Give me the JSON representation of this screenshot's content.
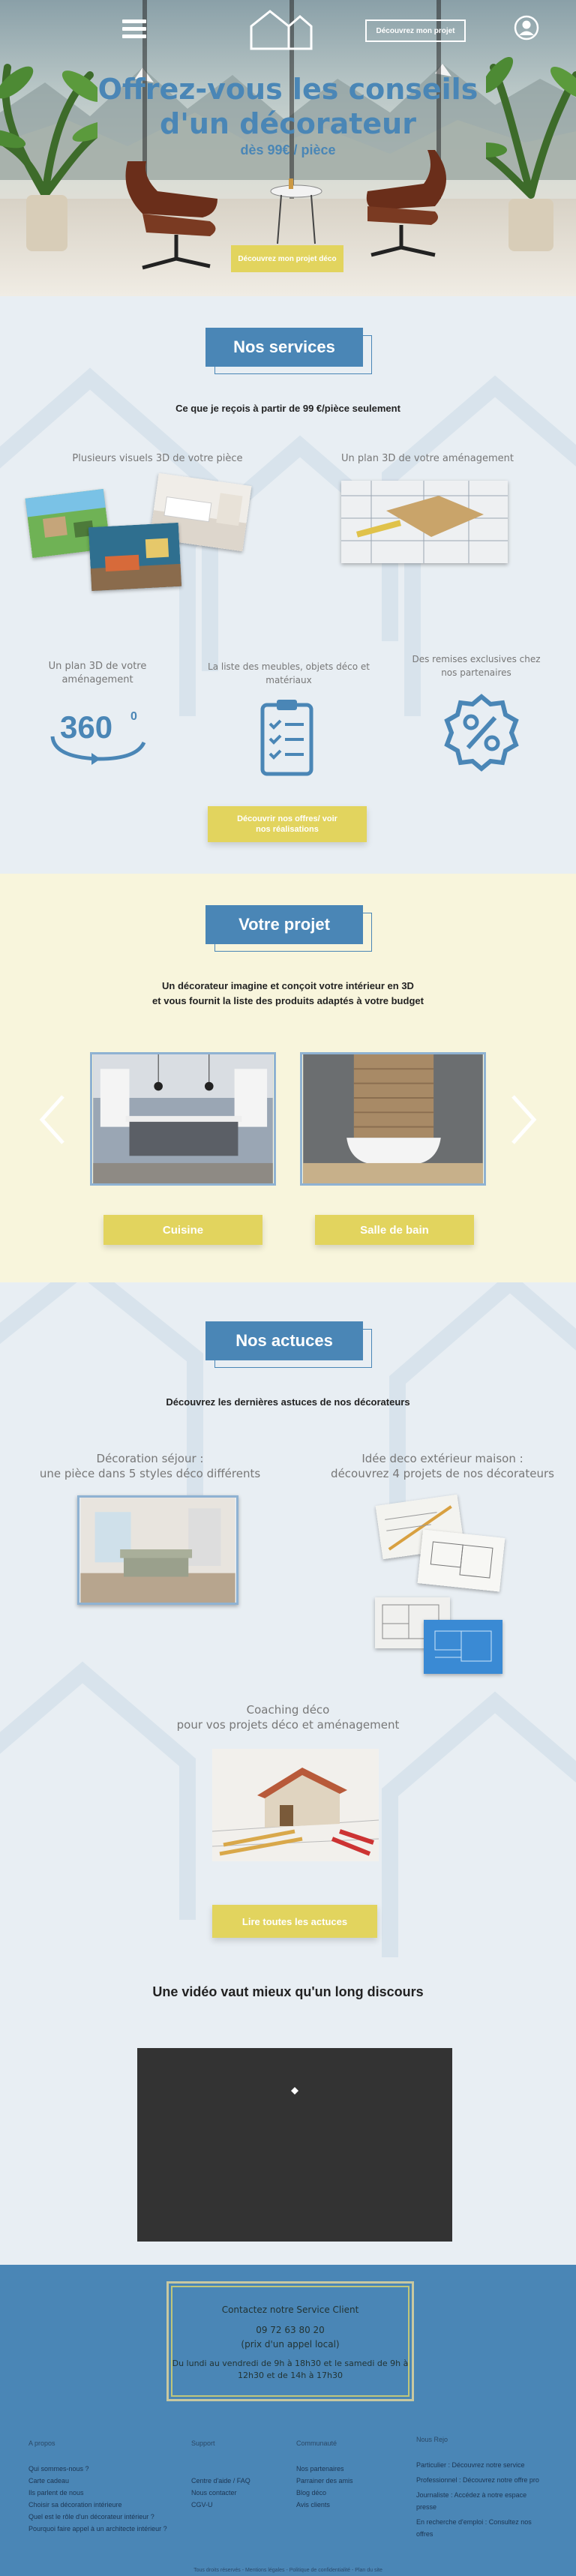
{
  "header": {
    "cta_label": "Découvrez mon projet"
  },
  "hero": {
    "title_line1": "Offrez-vous les conseils",
    "title_line2": "d'un décorateur",
    "subtitle": "dès 99€ / pièce",
    "cta_label": "Découvrez mon projet déco"
  },
  "services": {
    "title": "Nos services",
    "lead": "Ce que je reçois à partir de 99 €/pièce seulement",
    "items": [
      {
        "label": "Plusieurs visuels 3D de votre pièce"
      },
      {
        "label": "Un plan 3D de votre aménagement"
      },
      {
        "label": "Un plan 3D de votre aménagement"
      },
      {
        "label": "La liste des meubles, objets déco et matériaux"
      },
      {
        "label": "Des remises exclusives chez nos partenaires"
      }
    ],
    "icon_360_text": "360",
    "icon_360_sup": "0",
    "cta_label": "Découvrir nos offres/ voir nos réalisations"
  },
  "projet": {
    "title": "Votre projet",
    "lead_line1": "Un décorateur imagine et conçoit votre intérieur en 3D",
    "lead_line2": "et vous fournit la liste des produits adaptés à votre budget",
    "cards": [
      {
        "label": "Cuisine"
      },
      {
        "label": "Salle de bain"
      }
    ]
  },
  "actuces": {
    "title": "Nos actuces",
    "lead": "Découvrez les dernières astuces de nos décorateurs",
    "articles": [
      {
        "line1": "Décoration séjour :",
        "line2": "une pièce dans 5 styles déco différents"
      },
      {
        "line1": "Idée deco extérieur maison :",
        "line2": "découvrez 4 projets de nos décorateurs"
      },
      {
        "line1": "Coaching déco",
        "line2": "pour vos projets déco et aménagement"
      }
    ],
    "cta_label": "Lire toutes les actuces",
    "video_heading": "Une vidéo vaut mieux qu'un long discours"
  },
  "footer": {
    "contact": {
      "line1": "Contactez notre Service Client",
      "phone": "09 72 63 80 20",
      "price_note": "(prix d'un appel local)",
      "hours1": "Du lundi au vendredi de 9h à 18h30 et le samedi de 9h à",
      "hours2": "12h30 et de 14h à 17h30"
    },
    "columns": [
      {
        "heading": "A propos",
        "links": [
          "Qui sommes-nous ?",
          "Carte cadeau",
          "Ils parlent de nous",
          "Choisir sa décoration intérieure",
          "Quel est le rôle d'un décorateur intérieur ?",
          "Pourquoi faire appel à un architecte intérieur ?"
        ]
      },
      {
        "heading": "Support",
        "links": [
          "Centre d'aide / FAQ",
          "Nous contacter",
          "CGV-U"
        ]
      },
      {
        "heading": "Communauté",
        "links": [
          "Nos partenaires",
          "Parrainer des amis",
          "Blog déco",
          "Avis clients"
        ]
      },
      {
        "heading": "Nous Rejo",
        "links": [
          "Particulier : Découvrez notre service",
          "Professionnel : Découvrez notre offre pro",
          "Journaliste : Accédez à notre espace presse",
          "En recherche d'emploi : Consultez nos offres"
        ]
      }
    ],
    "copyright": "Tous droits réservés - Mentions légales - Politique de confidentialité - Plan du site"
  },
  "colors": {
    "primary_blue": "#4a86b6",
    "accent_yellow": "#e2d45e",
    "cream": "#f8f5dc"
  }
}
